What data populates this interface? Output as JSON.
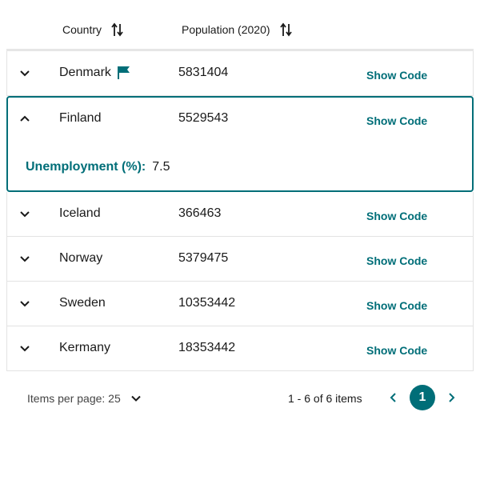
{
  "header": {
    "country_label": "Country",
    "population_label": "Population (2020)"
  },
  "rows": [
    {
      "country": "Denmark",
      "population": "5831404",
      "action": "Show Code",
      "flagged": true
    },
    {
      "country": "Finland",
      "population": "5529543",
      "action": "Show Code",
      "expanded": true,
      "detail_label": "Unemployment (%):",
      "detail_value": "7.5"
    },
    {
      "country": "Iceland",
      "population": "366463",
      "action": "Show Code"
    },
    {
      "country": "Norway",
      "population": "5379475",
      "action": "Show Code"
    },
    {
      "country": "Sweden",
      "population": "10353442",
      "action": "Show Code"
    },
    {
      "country": "Kermany",
      "population": "18353442",
      "action": "Show Code"
    }
  ],
  "footer": {
    "items_per_page_label": "Items per page: 25",
    "range_label": "1 - 6 of 6 items",
    "current_page": "1"
  },
  "colors": {
    "accent": "#006e78",
    "divider": "#e3e3e3"
  },
  "icons": {
    "sort": "sort-arrows-icon",
    "expand": "chevron-down-icon",
    "collapse": "chevron-up-icon",
    "flag": "flag-icon",
    "prev": "chevron-left-icon",
    "next": "chevron-right-icon"
  }
}
